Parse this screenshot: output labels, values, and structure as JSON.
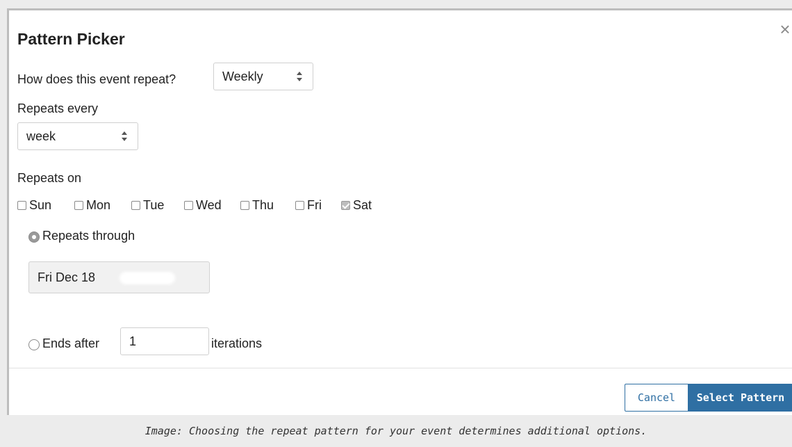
{
  "dialog": {
    "title": "Pattern Picker",
    "close_icon": "close-icon"
  },
  "repeat": {
    "question": "How does this event repeat?",
    "selected": "Weekly"
  },
  "repeats_every": {
    "label": "Repeats every",
    "selected": "week"
  },
  "repeats_on": {
    "label": "Repeats on",
    "days": [
      {
        "label": "Sun",
        "checked": false
      },
      {
        "label": "Mon",
        "checked": false
      },
      {
        "label": "Tue",
        "checked": false
      },
      {
        "label": "Wed",
        "checked": false
      },
      {
        "label": "Thu",
        "checked": false
      },
      {
        "label": "Fri",
        "checked": false
      },
      {
        "label": "Sat",
        "checked": true
      }
    ]
  },
  "end_options": {
    "through_label": "Repeats through",
    "through_selected": true,
    "through_date": "Fri Dec 18",
    "after_label": "Ends after",
    "after_value": "1",
    "after_suffix": "iterations"
  },
  "footer": {
    "cancel_label": "Cancel",
    "select_label": "Select Pattern"
  },
  "caption": "Image: Choosing the repeat pattern for your event determines additional options.",
  "colors": {
    "accent": "#2f6fa3",
    "backdrop": "#ececec"
  }
}
